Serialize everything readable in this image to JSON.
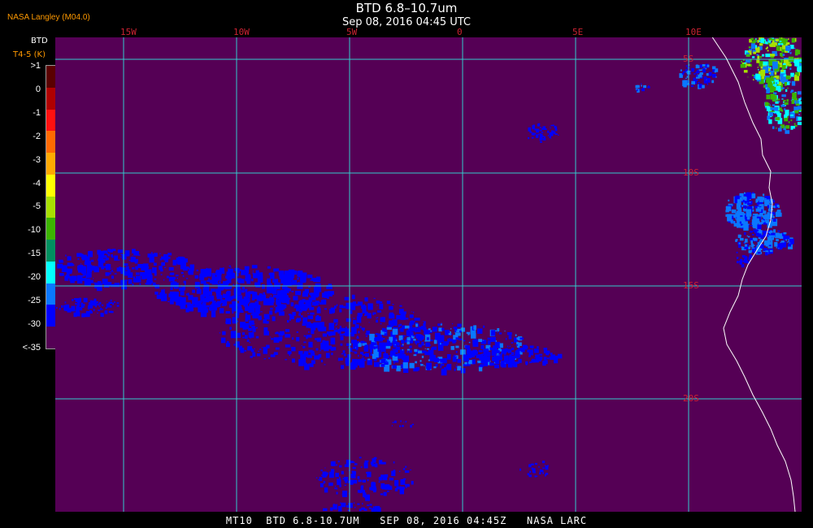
{
  "header": {
    "title": "BTD 6.8–10.7um",
    "datetime": "Sep 08, 2016 04:45 UTC",
    "credit": "NASA Langley (M04.0)"
  },
  "legend": {
    "label": "BTD",
    "unit": "T4-5 (K)",
    "ticks": [
      ">1",
      "0",
      "-1",
      "-2",
      "-3",
      "-4",
      "-5",
      "-10",
      "-15",
      "-20",
      "-25",
      "-30",
      "<-35"
    ],
    "colors": [
      "#5a0000",
      "#b00000",
      "#ff1010",
      "#ff6a00",
      "#ffaa00",
      "#ffff00",
      "#a8e000",
      "#3cb400",
      "#009060",
      "#00ffff",
      "#0a78ff",
      "#0000ff",
      "#550055"
    ]
  },
  "map": {
    "background_color": "#550055",
    "grid_color": "#33cccc",
    "cloud_colors": [
      "#0000ff",
      "#0a78ff",
      "#00ffff",
      "#3cb400",
      "#a8e000"
    ],
    "lon_labels": [
      "15W",
      "10W",
      "5W",
      "0",
      "5E",
      "10E"
    ],
    "lat_labels": [
      "5S",
      "10S",
      "15S",
      "20S"
    ]
  },
  "footer": {
    "text": "MT10  BTD 6.8-10.7UM   SEP 08, 2016 04:45Z   NASA LARC"
  }
}
